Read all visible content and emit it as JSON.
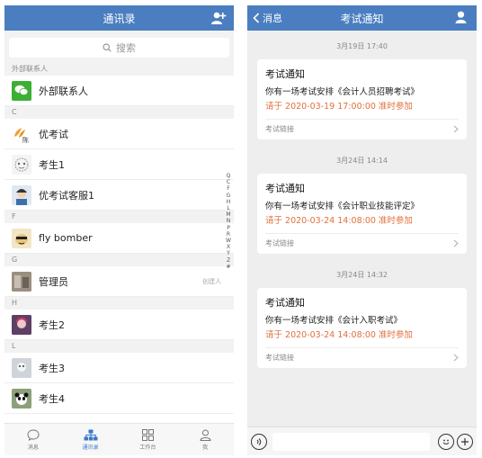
{
  "contacts_screen": {
    "title": "通讯录",
    "search_placeholder": "搜索",
    "sections": [
      {
        "header": "外部联系人",
        "items": [
          {
            "name": "外部联系人",
            "tag": ""
          }
        ]
      },
      {
        "header": "C",
        "items": [
          {
            "name": "优考试",
            "tag": ""
          },
          {
            "name": "考生1",
            "tag": ""
          },
          {
            "name": "优考试客服1",
            "tag": ""
          }
        ]
      },
      {
        "header": "F",
        "items": [
          {
            "name": "fly bomber",
            "tag": ""
          }
        ]
      },
      {
        "header": "G",
        "items": [
          {
            "name": "管理员",
            "tag": "创建人"
          }
        ]
      },
      {
        "header": "H",
        "items": [
          {
            "name": "考生2",
            "tag": ""
          }
        ]
      },
      {
        "header": "L",
        "items": [
          {
            "name": "考生3",
            "tag": ""
          },
          {
            "name": "考生4",
            "tag": ""
          }
        ]
      }
    ],
    "index_letters": [
      "Q",
      "C",
      "F",
      "G",
      "H",
      "L",
      "M",
      "N",
      "P",
      "R",
      "W",
      "X",
      "Y",
      "Z",
      "#"
    ],
    "tabs": [
      {
        "label": "消息",
        "icon": "chat-icon",
        "active": false
      },
      {
        "label": "通讯录",
        "icon": "org-chart-icon",
        "active": true
      },
      {
        "label": "工作台",
        "icon": "grid-icon",
        "active": false
      },
      {
        "label": "我",
        "icon": "person-icon",
        "active": false
      }
    ]
  },
  "chat_screen": {
    "back_label": "消息",
    "title": "考试通知",
    "messages": [
      {
        "time": "3月19日 17:40",
        "title": "考试通知",
        "line": "你有一场考试安排《会计人员招聘考试》",
        "notice": "请于 2020-03-19 17:00:00 准时参加",
        "link": "考试链接"
      },
      {
        "time": "3月24日 14:14",
        "title": "考试通知",
        "line": "你有一场考试安排《会计职业技能评定》",
        "notice": "请于 2020-03-24 14:08:00 准时参加",
        "link": "考试链接"
      },
      {
        "time": "3月24日 14:32",
        "title": "考试通知",
        "line": "你有一场考试安排《会计入职考试》",
        "notice": "请于 2020-03-24 14:08:00 准时参加",
        "link": "考试链接"
      }
    ]
  },
  "colors": {
    "header": "#4a7ec0",
    "accent_tab": "#3b78c8",
    "notice_red": "#e0703c",
    "wechat_green": "#3cb034"
  }
}
